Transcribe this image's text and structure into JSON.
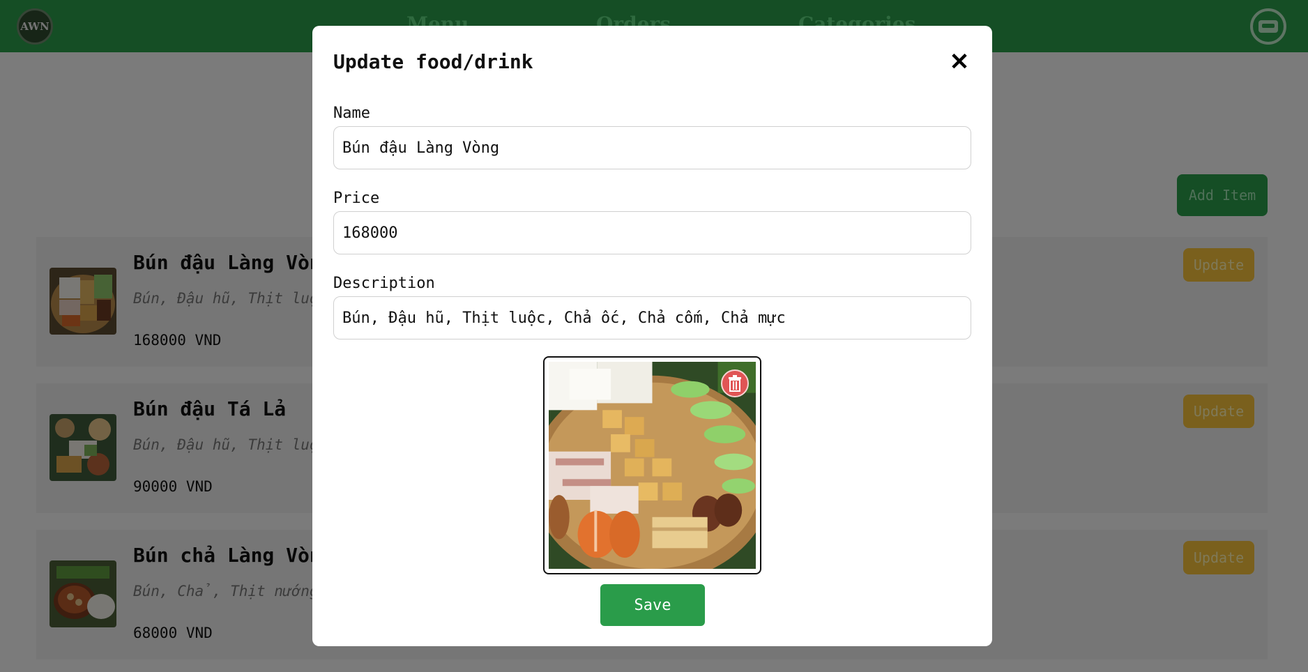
{
  "header": {
    "logo_text": "AWN",
    "nav": [
      {
        "label": "Menu"
      },
      {
        "label": "Orders"
      },
      {
        "label": "Categories"
      }
    ],
    "account_icon": "sofa-icon"
  },
  "page": {
    "add_item_label": "Add Item",
    "items": [
      {
        "name": "Bún đậu Làng Vòng",
        "description": "Bún, Đậu hũ, Thịt luộc, Chả ốc, Chả cốm, Chả mực",
        "price": "168000 VND",
        "update_label": "Update"
      },
      {
        "name": "Bún đậu Tá Lả",
        "description": "Bún, Đậu hũ, Thịt luộc",
        "price": "90000 VND",
        "update_label": "Update"
      },
      {
        "name": "Bún chả Làng Vòng",
        "description": "Bún, Chả, Thịt nướng",
        "price": "68000 VND",
        "update_label": "Update"
      }
    ]
  },
  "modal": {
    "title": "Update food/drink",
    "close_icon": "close-icon",
    "name_label": "Name",
    "name_value": "Bún đậu Làng Vòng",
    "price_label": "Price",
    "price_value": "168000",
    "description_label": "Description",
    "description_value": "Bún, Đậu hũ, Thịt luộc, Chả ốc, Chả cốm, Chả mực",
    "delete_icon": "trash-icon",
    "save_label": "Save"
  },
  "colors": {
    "brand_green": "#2a9c4a",
    "update_yellow": "#f4c03a",
    "delete_red": "#e05555"
  }
}
